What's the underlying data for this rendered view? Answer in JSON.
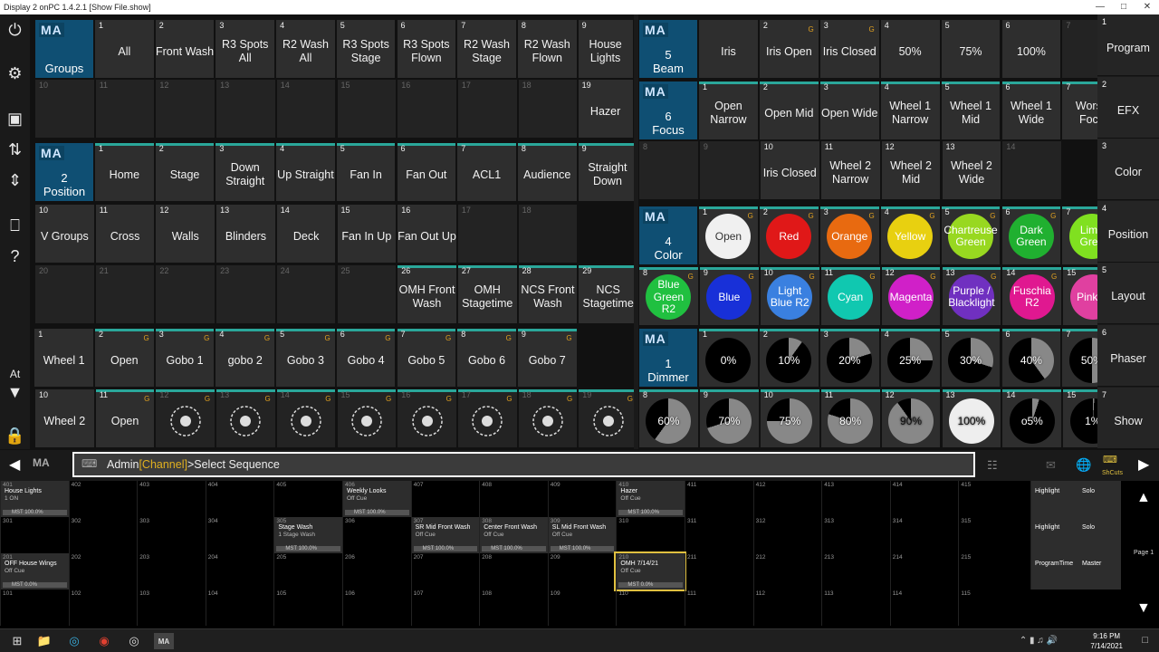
{
  "titlebar": {
    "title": "Display 2 onPC 1.4.2.1 [Show File.show]"
  },
  "sidebar": {
    "at_label": "At"
  },
  "groups": {
    "ma": "MA",
    "name": "Groups",
    "items": [
      {
        "n": "1",
        "t": "All"
      },
      {
        "n": "2",
        "t": "Front Wash"
      },
      {
        "n": "3",
        "t": "R3 Spots All"
      },
      {
        "n": "4",
        "t": "R2 Wash All"
      },
      {
        "n": "5",
        "t": "R3 Spots Stage"
      },
      {
        "n": "6",
        "t": "R3 Spots Flown"
      },
      {
        "n": "7",
        "t": "R2 Wash Stage"
      },
      {
        "n": "8",
        "t": "R2 Wash Flown"
      },
      {
        "n": "9",
        "t": "House Lights"
      }
    ],
    "row2": [
      "10",
      "11",
      "12",
      "13",
      "14",
      "15",
      "16",
      "17",
      "18"
    ],
    "hazer": {
      "n": "19",
      "t": "Hazer"
    }
  },
  "position": {
    "ma": "MA",
    "num": "2",
    "name": "Position",
    "row1": [
      {
        "n": "1",
        "t": "Home"
      },
      {
        "n": "2",
        "t": "Stage"
      },
      {
        "n": "3",
        "t": "Down Straight"
      },
      {
        "n": "4",
        "t": "Up Straight"
      },
      {
        "n": "5",
        "t": "Fan In"
      },
      {
        "n": "6",
        "t": "Fan Out"
      },
      {
        "n": "7",
        "t": "ACL1"
      },
      {
        "n": "8",
        "t": "Audience"
      },
      {
        "n": "9",
        "t": "Straight Down"
      }
    ],
    "row2": [
      {
        "n": "10",
        "t": "V Groups"
      },
      {
        "n": "11",
        "t": "Cross"
      },
      {
        "n": "12",
        "t": "Walls"
      },
      {
        "n": "13",
        "t": "Blinders"
      },
      {
        "n": "14",
        "t": "Deck"
      },
      {
        "n": "15",
        "t": "Fan In Up"
      },
      {
        "n": "16",
        "t": "Fan Out Up"
      },
      {
        "n": "17",
        "t": ""
      },
      {
        "n": "18",
        "t": ""
      }
    ],
    "row3": [
      {
        "n": "20",
        "t": ""
      },
      {
        "n": "21",
        "t": ""
      },
      {
        "n": "22",
        "t": ""
      },
      {
        "n": "23",
        "t": ""
      },
      {
        "n": "24",
        "t": ""
      },
      {
        "n": "25",
        "t": ""
      },
      {
        "n": "26",
        "t": "OMH Front Wash"
      },
      {
        "n": "27",
        "t": "OMH Stagetime"
      },
      {
        "n": "28",
        "t": "NCS Front Wash"
      },
      {
        "n": "29",
        "t": "NCS Stagetime"
      }
    ]
  },
  "gobo": {
    "ma": "MA",
    "num": "3",
    "name": "Gobo",
    "row1": [
      {
        "n": "1",
        "t": "Wheel 1"
      },
      {
        "n": "2",
        "t": "Open"
      },
      {
        "n": "3",
        "t": "Gobo 1"
      },
      {
        "n": "4",
        "t": "gobo 2"
      },
      {
        "n": "5",
        "t": "Gobo 3"
      },
      {
        "n": "6",
        "t": "Gobo 4"
      },
      {
        "n": "7",
        "t": "Gobo 5"
      },
      {
        "n": "8",
        "t": "Gobo 6"
      },
      {
        "n": "9",
        "t": "Gobo 7"
      }
    ],
    "row2": [
      {
        "n": "10",
        "t": "Wheel 2"
      },
      {
        "n": "11",
        "t": "Open"
      },
      {
        "n": "12",
        "t": ""
      },
      {
        "n": "13",
        "t": ""
      },
      {
        "n": "14",
        "t": ""
      },
      {
        "n": "15",
        "t": ""
      },
      {
        "n": "16",
        "t": ""
      },
      {
        "n": "17",
        "t": ""
      },
      {
        "n": "18",
        "t": ""
      },
      {
        "n": "19",
        "t": ""
      }
    ]
  },
  "beam": {
    "ma": "MA",
    "num": "5",
    "name": "Beam",
    "items": [
      {
        "n": "",
        "t": "Iris"
      },
      {
        "n": "2",
        "t": "Iris Open"
      },
      {
        "n": "3",
        "t": "Iris Closed"
      },
      {
        "n": "4",
        "t": "50%"
      },
      {
        "n": "5",
        "t": "75%"
      },
      {
        "n": "6",
        "t": "100%"
      },
      {
        "n": "7",
        "t": ""
      }
    ]
  },
  "focus": {
    "ma": "MA",
    "num": "6",
    "name": "Focus",
    "row1": [
      {
        "n": "1",
        "t": "Open Narrow"
      },
      {
        "n": "2",
        "t": "Open Mid"
      },
      {
        "n": "3",
        "t": "Open Wide"
      },
      {
        "n": "4",
        "t": "Wheel 1 Narrow"
      },
      {
        "n": "5",
        "t": "Wheel 1 Mid"
      },
      {
        "n": "6",
        "t": "Wheel 1 Wide"
      },
      {
        "n": "7",
        "t": "Worsh Focu"
      }
    ],
    "row2": [
      {
        "n": "8",
        "t": ""
      },
      {
        "n": "9",
        "t": ""
      },
      {
        "n": "10",
        "t": "Iris Closed"
      },
      {
        "n": "11",
        "t": "Wheel 2 Narrow"
      },
      {
        "n": "12",
        "t": "Wheel 2 Mid"
      },
      {
        "n": "13",
        "t": "Wheel 2 Wide"
      },
      {
        "n": "14",
        "t": ""
      }
    ]
  },
  "color": {
    "ma": "MA",
    "num": "4",
    "name": "Color",
    "row1": [
      {
        "n": "1",
        "t": "Open",
        "c": "#f0f0f0"
      },
      {
        "n": "2",
        "t": "Red",
        "c": "#e01818"
      },
      {
        "n": "3",
        "t": "Orange",
        "c": "#e86a10"
      },
      {
        "n": "4",
        "t": "Yellow",
        "c": "#e8d010"
      },
      {
        "n": "5",
        "t": "Chartreuse Green",
        "c": "#98d820"
      },
      {
        "n": "6",
        "t": "Dark Green",
        "c": "#20b030"
      },
      {
        "n": "7",
        "t": "Lime Gree",
        "c": "#80e020"
      }
    ],
    "row2": [
      {
        "n": "8",
        "t": "Blue Green R2",
        "c": "#20c040"
      },
      {
        "n": "9",
        "t": "Blue",
        "c": "#1830d8"
      },
      {
        "n": "10",
        "t": "Light Blue R2",
        "c": "#3a80e0"
      },
      {
        "n": "11",
        "t": "Cyan",
        "c": "#10c8b0"
      },
      {
        "n": "12",
        "t": "Magenta",
        "c": "#d020c8"
      },
      {
        "n": "13",
        "t": "Purple / Blacklight",
        "c": "#7030c0"
      },
      {
        "n": "14",
        "t": "Fuschia R2",
        "c": "#e01890"
      },
      {
        "n": "15",
        "t": "Pink R",
        "c": "#e040a0"
      }
    ]
  },
  "dimmer": {
    "ma": "MA",
    "num": "1",
    "name": "Dimmer",
    "row1": [
      {
        "n": "1",
        "t": "0%",
        "v": 0
      },
      {
        "n": "2",
        "t": "10%",
        "v": 10
      },
      {
        "n": "3",
        "t": "20%",
        "v": 20
      },
      {
        "n": "4",
        "t": "25%",
        "v": 25
      },
      {
        "n": "5",
        "t": "30%",
        "v": 30
      },
      {
        "n": "6",
        "t": "40%",
        "v": 40
      },
      {
        "n": "7",
        "t": "50%",
        "v": 50
      }
    ],
    "row2": [
      {
        "n": "8",
        "t": "60%",
        "v": 60
      },
      {
        "n": "9",
        "t": "70%",
        "v": 70
      },
      {
        "n": "10",
        "t": "75%",
        "v": 75
      },
      {
        "n": "11",
        "t": "80%",
        "v": 80
      },
      {
        "n": "12",
        "t": "90%",
        "v": 90
      },
      {
        "n": "13",
        "t": "100%",
        "v": 100
      },
      {
        "n": "14",
        "t": "o5%",
        "v": 5
      },
      {
        "n": "15",
        "t": "1%",
        "v": 1
      }
    ]
  },
  "right_tabs": [
    {
      "n": "1",
      "t": "Program"
    },
    {
      "n": "2",
      "t": "EFX"
    },
    {
      "n": "3",
      "t": "Color"
    },
    {
      "n": "4",
      "t": "Position"
    },
    {
      "n": "5",
      "t": "Layout"
    },
    {
      "n": "6",
      "t": "Phaser"
    },
    {
      "n": "7",
      "t": "Show"
    }
  ],
  "command": {
    "prefix": "Admin",
    "channel": "[Channel]",
    "rest": ">Select Sequence",
    "ma": "MA",
    "shortcuts": "ShCuts"
  },
  "executors": {
    "row4": [
      {
        "n": "401",
        "t": "House Lights",
        "sub": "1 ON",
        "bar": "MST 100.0%",
        "active": true
      },
      {
        "n": "402"
      },
      {
        "n": "403"
      },
      {
        "n": "404"
      },
      {
        "n": "405"
      },
      {
        "n": "406",
        "t": "Weekly Looks",
        "sub": "Off Cue",
        "bar": "MST 100.0%",
        "active": true
      },
      {
        "n": "407"
      },
      {
        "n": "408"
      },
      {
        "n": "409"
      },
      {
        "n": "410",
        "t": "Hazer",
        "sub": "Off Cue",
        "bar": "MST 100.0%",
        "active": true
      },
      {
        "n": "411"
      },
      {
        "n": "412"
      },
      {
        "n": "413"
      },
      {
        "n": "414"
      },
      {
        "n": "415"
      }
    ],
    "row3": [
      {
        "n": "301"
      },
      {
        "n": "302"
      },
      {
        "n": "303"
      },
      {
        "n": "304"
      },
      {
        "n": "305",
        "t": "Stage Wash",
        "sub": "1 Stage Wash",
        "bar": "MST 100.0%",
        "active": true
      },
      {
        "n": "306"
      },
      {
        "n": "307",
        "t": "SR Mid Front Wash",
        "sub": "Off Cue",
        "bar": "MST 100.0%",
        "active": true
      },
      {
        "n": "308",
        "t": "Center Front Wash",
        "sub": "Off Cue",
        "bar": "MST 100.0%",
        "active": true
      },
      {
        "n": "309",
        "t": "SL Mid Front Wash",
        "sub": "Off Cue",
        "bar": "MST 100.0%",
        "active": true
      },
      {
        "n": "310"
      },
      {
        "n": "311"
      },
      {
        "n": "312"
      },
      {
        "n": "313"
      },
      {
        "n": "314"
      },
      {
        "n": "315"
      }
    ],
    "row2": [
      {
        "n": "201",
        "t": "OFF House Wings",
        "sub": "Off Cue",
        "bar": "MST 0.0%",
        "active": true
      },
      {
        "n": "202"
      },
      {
        "n": "203"
      },
      {
        "n": "204"
      },
      {
        "n": "205"
      },
      {
        "n": "206"
      },
      {
        "n": "207"
      },
      {
        "n": "208"
      },
      {
        "n": "209"
      },
      {
        "n": "210",
        "t": "OMH 7/14/21",
        "sub": "Off Cue",
        "bar": "MST 0.0%",
        "active": true
      },
      {
        "n": "211"
      },
      {
        "n": "212"
      },
      {
        "n": "213"
      },
      {
        "n": "214"
      },
      {
        "n": "215"
      }
    ],
    "row1": [
      "101",
      "102",
      "103",
      "104",
      "105",
      "106",
      "107",
      "108",
      "109",
      "110",
      "111",
      "112",
      "113",
      "114",
      "115"
    ],
    "special": [
      {
        "t": "Highlight",
        "t2": "Solo"
      },
      {
        "t": "Highlight",
        "t2": "Solo"
      },
      {
        "t": "ProgramTime",
        "t2": "Master"
      }
    ],
    "page_label": "Page 1"
  },
  "taskbar": {
    "time": "9:16 PM",
    "date": "7/14/2021"
  }
}
